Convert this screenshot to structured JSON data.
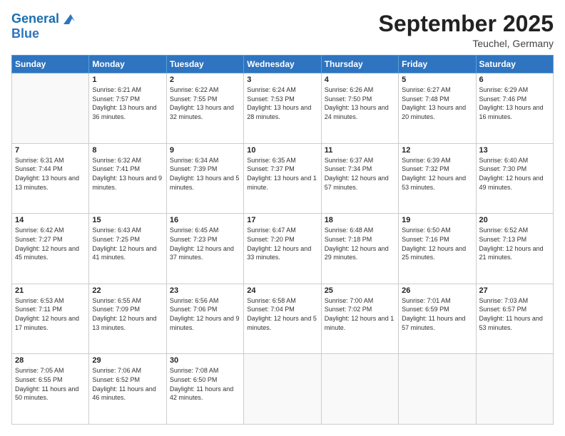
{
  "header": {
    "logo_line1": "General",
    "logo_line2": "Blue",
    "month_title": "September 2025",
    "location": "Teuchel, Germany"
  },
  "weekdays": [
    "Sunday",
    "Monday",
    "Tuesday",
    "Wednesday",
    "Thursday",
    "Friday",
    "Saturday"
  ],
  "weeks": [
    [
      {
        "day": "",
        "empty": true
      },
      {
        "day": "1",
        "sunrise": "Sunrise: 6:21 AM",
        "sunset": "Sunset: 7:57 PM",
        "daylight": "Daylight: 13 hours and 36 minutes."
      },
      {
        "day": "2",
        "sunrise": "Sunrise: 6:22 AM",
        "sunset": "Sunset: 7:55 PM",
        "daylight": "Daylight: 13 hours and 32 minutes."
      },
      {
        "day": "3",
        "sunrise": "Sunrise: 6:24 AM",
        "sunset": "Sunset: 7:53 PM",
        "daylight": "Daylight: 13 hours and 28 minutes."
      },
      {
        "day": "4",
        "sunrise": "Sunrise: 6:26 AM",
        "sunset": "Sunset: 7:50 PM",
        "daylight": "Daylight: 13 hours and 24 minutes."
      },
      {
        "day": "5",
        "sunrise": "Sunrise: 6:27 AM",
        "sunset": "Sunset: 7:48 PM",
        "daylight": "Daylight: 13 hours and 20 minutes."
      },
      {
        "day": "6",
        "sunrise": "Sunrise: 6:29 AM",
        "sunset": "Sunset: 7:46 PM",
        "daylight": "Daylight: 13 hours and 16 minutes."
      }
    ],
    [
      {
        "day": "7",
        "sunrise": "Sunrise: 6:31 AM",
        "sunset": "Sunset: 7:44 PM",
        "daylight": "Daylight: 13 hours and 13 minutes."
      },
      {
        "day": "8",
        "sunrise": "Sunrise: 6:32 AM",
        "sunset": "Sunset: 7:41 PM",
        "daylight": "Daylight: 13 hours and 9 minutes."
      },
      {
        "day": "9",
        "sunrise": "Sunrise: 6:34 AM",
        "sunset": "Sunset: 7:39 PM",
        "daylight": "Daylight: 13 hours and 5 minutes."
      },
      {
        "day": "10",
        "sunrise": "Sunrise: 6:35 AM",
        "sunset": "Sunset: 7:37 PM",
        "daylight": "Daylight: 13 hours and 1 minute."
      },
      {
        "day": "11",
        "sunrise": "Sunrise: 6:37 AM",
        "sunset": "Sunset: 7:34 PM",
        "daylight": "Daylight: 12 hours and 57 minutes."
      },
      {
        "day": "12",
        "sunrise": "Sunrise: 6:39 AM",
        "sunset": "Sunset: 7:32 PM",
        "daylight": "Daylight: 12 hours and 53 minutes."
      },
      {
        "day": "13",
        "sunrise": "Sunrise: 6:40 AM",
        "sunset": "Sunset: 7:30 PM",
        "daylight": "Daylight: 12 hours and 49 minutes."
      }
    ],
    [
      {
        "day": "14",
        "sunrise": "Sunrise: 6:42 AM",
        "sunset": "Sunset: 7:27 PM",
        "daylight": "Daylight: 12 hours and 45 minutes."
      },
      {
        "day": "15",
        "sunrise": "Sunrise: 6:43 AM",
        "sunset": "Sunset: 7:25 PM",
        "daylight": "Daylight: 12 hours and 41 minutes."
      },
      {
        "day": "16",
        "sunrise": "Sunrise: 6:45 AM",
        "sunset": "Sunset: 7:23 PM",
        "daylight": "Daylight: 12 hours and 37 minutes."
      },
      {
        "day": "17",
        "sunrise": "Sunrise: 6:47 AM",
        "sunset": "Sunset: 7:20 PM",
        "daylight": "Daylight: 12 hours and 33 minutes."
      },
      {
        "day": "18",
        "sunrise": "Sunrise: 6:48 AM",
        "sunset": "Sunset: 7:18 PM",
        "daylight": "Daylight: 12 hours and 29 minutes."
      },
      {
        "day": "19",
        "sunrise": "Sunrise: 6:50 AM",
        "sunset": "Sunset: 7:16 PM",
        "daylight": "Daylight: 12 hours and 25 minutes."
      },
      {
        "day": "20",
        "sunrise": "Sunrise: 6:52 AM",
        "sunset": "Sunset: 7:13 PM",
        "daylight": "Daylight: 12 hours and 21 minutes."
      }
    ],
    [
      {
        "day": "21",
        "sunrise": "Sunrise: 6:53 AM",
        "sunset": "Sunset: 7:11 PM",
        "daylight": "Daylight: 12 hours and 17 minutes."
      },
      {
        "day": "22",
        "sunrise": "Sunrise: 6:55 AM",
        "sunset": "Sunset: 7:09 PM",
        "daylight": "Daylight: 12 hours and 13 minutes."
      },
      {
        "day": "23",
        "sunrise": "Sunrise: 6:56 AM",
        "sunset": "Sunset: 7:06 PM",
        "daylight": "Daylight: 12 hours and 9 minutes."
      },
      {
        "day": "24",
        "sunrise": "Sunrise: 6:58 AM",
        "sunset": "Sunset: 7:04 PM",
        "daylight": "Daylight: 12 hours and 5 minutes."
      },
      {
        "day": "25",
        "sunrise": "Sunrise: 7:00 AM",
        "sunset": "Sunset: 7:02 PM",
        "daylight": "Daylight: 12 hours and 1 minute."
      },
      {
        "day": "26",
        "sunrise": "Sunrise: 7:01 AM",
        "sunset": "Sunset: 6:59 PM",
        "daylight": "Daylight: 11 hours and 57 minutes."
      },
      {
        "day": "27",
        "sunrise": "Sunrise: 7:03 AM",
        "sunset": "Sunset: 6:57 PM",
        "daylight": "Daylight: 11 hours and 53 minutes."
      }
    ],
    [
      {
        "day": "28",
        "sunrise": "Sunrise: 7:05 AM",
        "sunset": "Sunset: 6:55 PM",
        "daylight": "Daylight: 11 hours and 50 minutes."
      },
      {
        "day": "29",
        "sunrise": "Sunrise: 7:06 AM",
        "sunset": "Sunset: 6:52 PM",
        "daylight": "Daylight: 11 hours and 46 minutes."
      },
      {
        "day": "30",
        "sunrise": "Sunrise: 7:08 AM",
        "sunset": "Sunset: 6:50 PM",
        "daylight": "Daylight: 11 hours and 42 minutes."
      },
      {
        "day": "",
        "empty": true
      },
      {
        "day": "",
        "empty": true
      },
      {
        "day": "",
        "empty": true
      },
      {
        "day": "",
        "empty": true
      }
    ]
  ]
}
